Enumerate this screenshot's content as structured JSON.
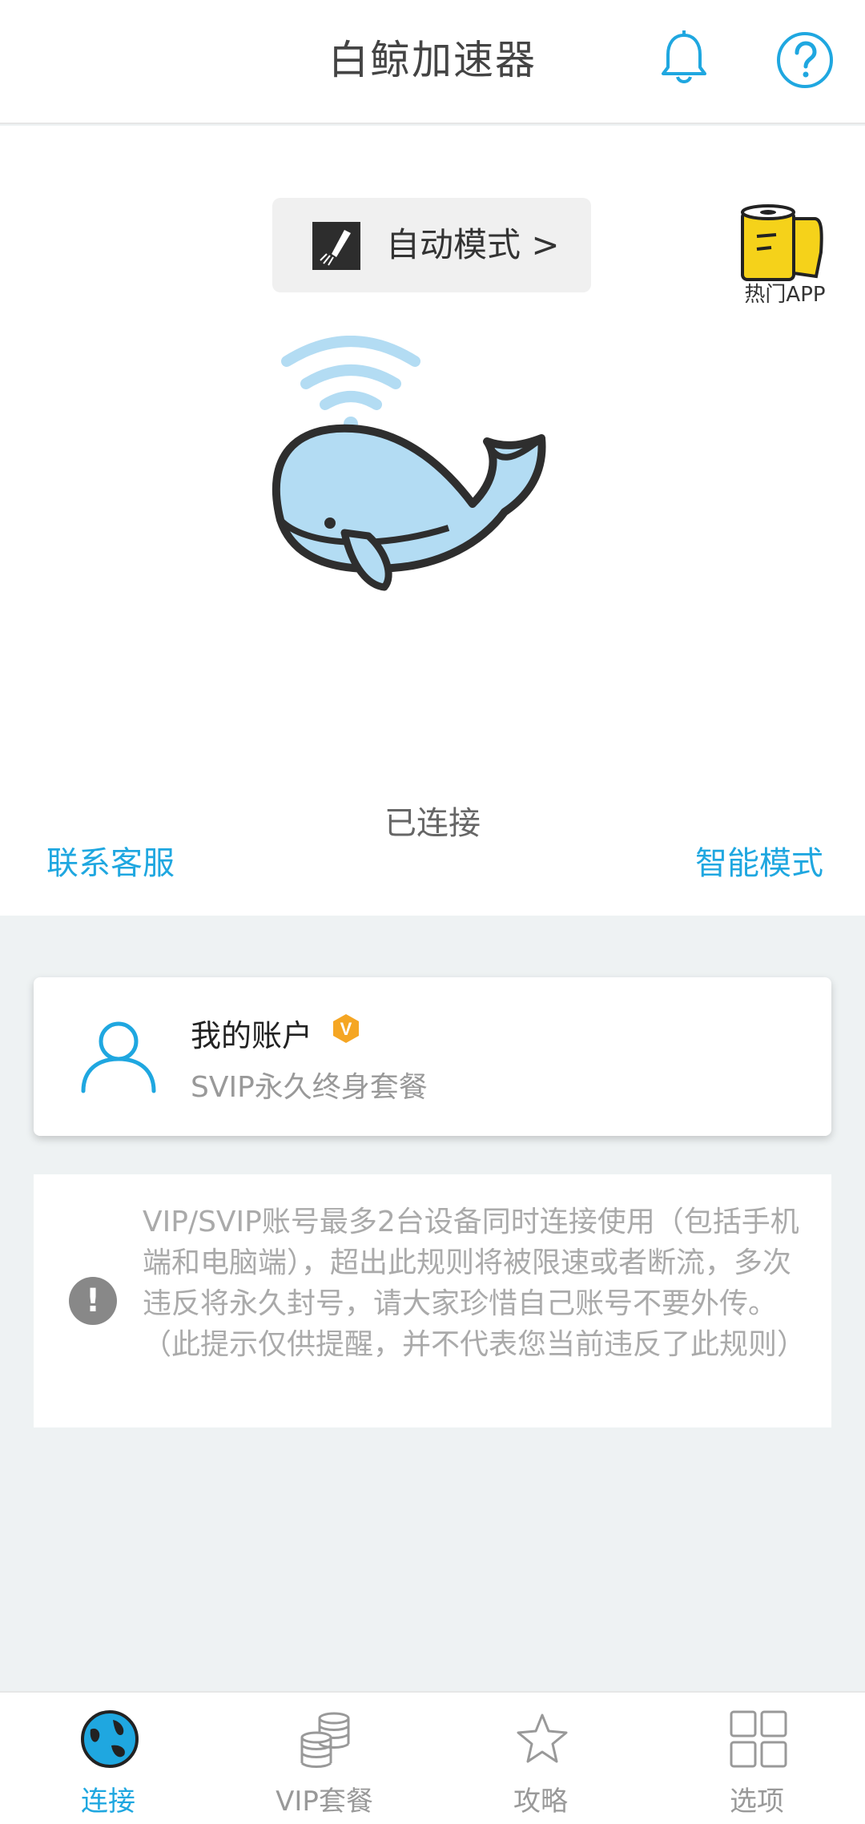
{
  "header": {
    "title": "白鲸加速器"
  },
  "hero": {
    "mode_label": "自动模式 >",
    "hot_app_label": "热门APP",
    "status": "已连接",
    "contact_label": "联系客服",
    "smart_label": "智能模式"
  },
  "account": {
    "title": "我的账户",
    "badge": "V",
    "subtitle": "SVIP永久终身套餐"
  },
  "notice": {
    "icon": "!",
    "text": "VIP/SVIP账号最多2台设备同时连接使用（包括手机端和电脑端），超出此规则将被限速或者断流，多次违反将永久封号，请大家珍惜自己账号不要外传。（此提示仅供提醒，并不代表您当前违反了此规则）"
  },
  "tabs": [
    {
      "label": "连接",
      "icon": "globe-icon",
      "active": true
    },
    {
      "label": "VIP套餐",
      "icon": "coins-icon",
      "active": false
    },
    {
      "label": "攻略",
      "icon": "star-icon",
      "active": false
    },
    {
      "label": "选项",
      "icon": "grid-icon",
      "active": false
    }
  ],
  "colors": {
    "accent": "#1fa7e0",
    "badge": "#f5a623",
    "whale": "#b3dcf3"
  }
}
